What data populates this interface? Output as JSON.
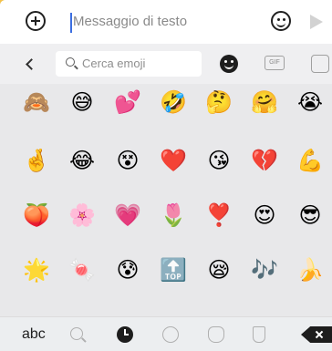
{
  "compose": {
    "placeholder": "Messaggio di testo"
  },
  "search": {
    "placeholder": "Cerca emoji"
  },
  "tabs": {
    "gif_label": "GIF"
  },
  "emoji_rows": [
    [
      "🙈",
      "😅",
      "💕",
      "🤣",
      "🤔",
      "🤗",
      "😭"
    ],
    [
      "🤞",
      "😂",
      "😵",
      "❤️",
      "😘",
      "💔",
      "💪"
    ],
    [
      "🍑",
      "🌸",
      "💗",
      "🌷",
      "❣️",
      "😍",
      "😎"
    ],
    [
      "🌟",
      "🍬",
      "😰",
      "🔝",
      "😪",
      "🎶",
      "🍌"
    ]
  ],
  "bottom_bar": {
    "abc_label": "abc"
  },
  "colors": {
    "accent_caret": "#3b6ee0",
    "frame": "#f4c24a",
    "panel": "#e8e8ea"
  }
}
